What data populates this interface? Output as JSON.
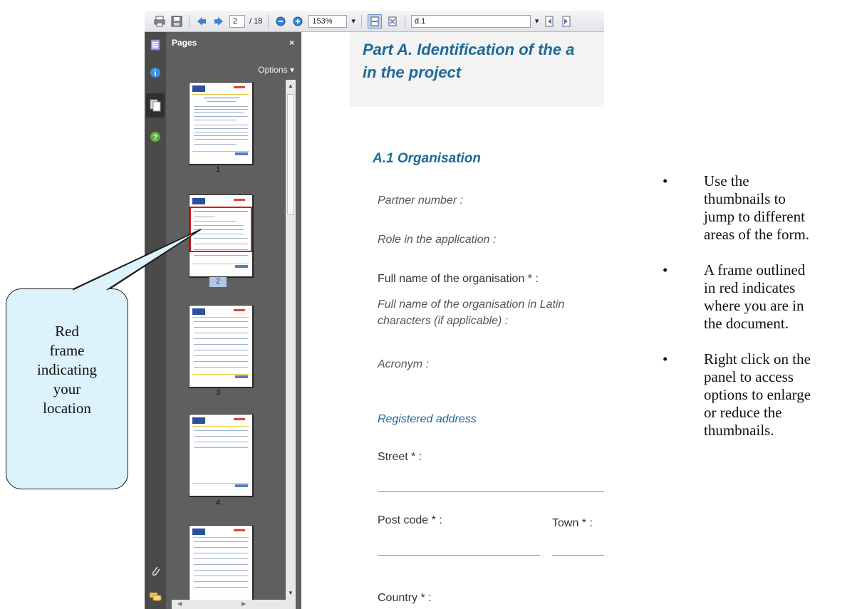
{
  "toolbar": {
    "page_current": "2",
    "page_total": "/ 18",
    "zoom": "153%",
    "search": "d.1"
  },
  "panel": {
    "title": "Pages",
    "close": "×",
    "options": "Options ▾",
    "thumbnails": [
      "1",
      "2",
      "3",
      "4"
    ]
  },
  "document": {
    "title_line1": "Part A. Identification of the a",
    "title_line2": "in the project",
    "section": "A.1 Organisation",
    "partner_number": "Partner number :",
    "role": "Role in the application :",
    "full_name": "Full name of the organisation * :",
    "latin_line1": "Full name of the organisation in Latin",
    "latin_line2": "characters (if applicable) :",
    "acronym": "Acronym :",
    "registered_address": "Registered address",
    "street": "Street * :",
    "post_code": "Post code * :",
    "town": "Town * :",
    "country": "Country * :"
  },
  "callout": {
    "text": "Red\nframe\nindicating\nyour\nlocation"
  },
  "bullets": [
    "Use the\nthumbnails to\njump to different\nareas of the form.",
    "A frame outlined\nin red indicates\nwhere you are in\nthe document.",
    "Right click on the\npanel to access\noptions to enlarge\nor reduce the\nthumbnails."
  ],
  "colors": {
    "accent": "#1d6a97",
    "red_frame": "#d21f1f",
    "callout_bg": "#ddf3fb",
    "panel_bg": "#5f5f5f"
  },
  "icons": [
    "print-icon",
    "save-icon",
    "previous-page-icon",
    "next-page-icon",
    "zoom-out-icon",
    "zoom-in-icon",
    "fit-width-icon",
    "fit-page-icon",
    "find-previous-icon",
    "find-next-icon",
    "bookmarks-icon",
    "info-icon",
    "pages-icon",
    "help-icon",
    "attachment-icon",
    "comments-icon"
  ]
}
